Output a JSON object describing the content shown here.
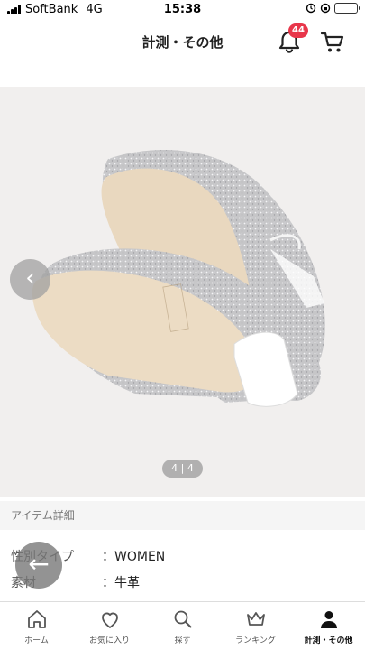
{
  "status_bar": {
    "carrier": "SoftBank",
    "network": "4G",
    "time": "15:38",
    "battery_percent": 100
  },
  "header": {
    "title": "計測・その他",
    "notification_count": "44"
  },
  "gallery": {
    "page_indicator": "4 | 4"
  },
  "details": {
    "section_title": "アイテム詳細",
    "rows": [
      {
        "label": "性別タイプ",
        "value": "：WOMEN"
      },
      {
        "label": "素材",
        "value": "：牛革"
      }
    ]
  },
  "tabbar": {
    "items": [
      {
        "label": "ホーム",
        "icon": "home-icon"
      },
      {
        "label": "お気に入り",
        "icon": "heart-icon"
      },
      {
        "label": "探す",
        "icon": "search-icon"
      },
      {
        "label": "ランキング",
        "icon": "crown-icon"
      },
      {
        "label": "計測・その他",
        "icon": "person-icon"
      }
    ]
  },
  "colors": {
    "accent": "#e8364a",
    "battery": "#3bb54a",
    "image_bg": "#f1efee"
  }
}
